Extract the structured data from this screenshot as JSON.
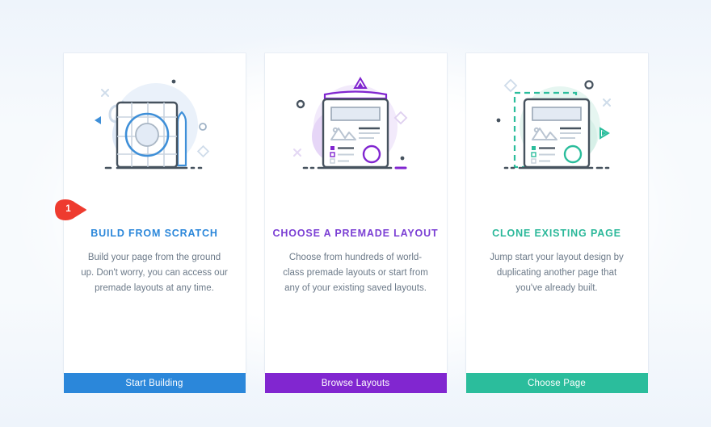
{
  "page": {
    "background_color": "#f3f7fc",
    "card_background": "#ffffff"
  },
  "badge": {
    "label": "1",
    "color": "#ee3b2f",
    "name": "step-badge-1"
  },
  "cards": [
    {
      "id": "build-from-scratch",
      "title": "BUILD FROM SCRATCH",
      "title_color": "#2b87da",
      "description": "Build your page from the ground up. Don't worry, you can access our premade layouts at any time.",
      "button_label": "Start Building",
      "button_color": "#2b87da",
      "illustration_name": "blueprint-page-illustration",
      "accent": "#2b87da"
    },
    {
      "id": "choose-premade-layout",
      "title": "CHOOSE A PREMADE LAYOUT",
      "title_color": "#7b3fd4",
      "description": "Choose from hundreds of world-class premade layouts or start from any of your existing saved layouts.",
      "button_label": "Browse Layouts",
      "button_color": "#8126d0",
      "illustration_name": "layout-page-illustration",
      "accent": "#7b3fd4"
    },
    {
      "id": "clone-existing-page",
      "title": "CLONE EXISTING PAGE",
      "title_color": "#2bb89a",
      "description": "Jump start your layout design by duplicating another page that you've already built.",
      "button_label": "Choose Page",
      "button_color": "#2bbd9c",
      "illustration_name": "clone-page-illustration",
      "accent": "#2bb89a"
    }
  ]
}
